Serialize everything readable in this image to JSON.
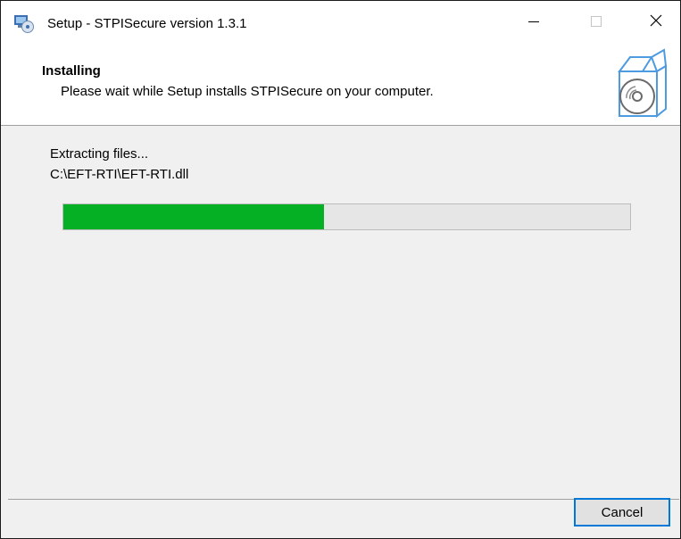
{
  "window": {
    "title": "Setup - STPISecure version 1.3.1",
    "app_icon": "setup-installer-icon",
    "controls": {
      "minimize": "minimize-icon",
      "maximize": "maximize-icon",
      "close": "close-icon"
    }
  },
  "header": {
    "title": "Installing",
    "subtitle": "Please wait while Setup installs STPISecure on your computer.",
    "icon": "software-box-icon"
  },
  "body": {
    "status": "Extracting files...",
    "current_file": "C:\\EFT-RTI\\EFT-RTI.dll",
    "progress_percent": 46
  },
  "footer": {
    "cancel_label": "Cancel"
  },
  "colors": {
    "progress_fill": "#06b025",
    "progress_track": "#e6e6e6",
    "button_focus_border": "#0078d7",
    "window_background": "#f0f0f0"
  }
}
